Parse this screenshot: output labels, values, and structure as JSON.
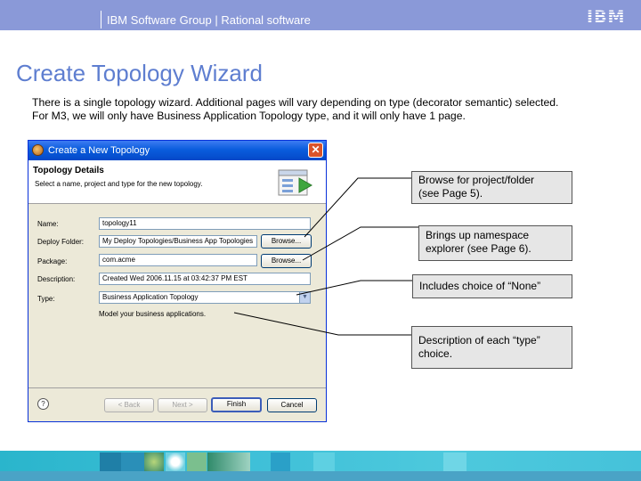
{
  "header": {
    "group_text": "IBM Software Group | Rational software",
    "logo_text": "IBM"
  },
  "slide": {
    "title": "Create Topology Wizard",
    "body_lines": [
      "There is a single topology wizard.  Additional pages will vary depending on type (decorator semantic) selected.",
      "For M3, we will only have Business Application Topology type, and it will only have 1 page."
    ]
  },
  "dialog": {
    "title": "Create a New Topology",
    "close_glyph": "✕",
    "banner": {
      "title": "Topology Details",
      "description": "Select a name, project and type for the new topology."
    },
    "fields": {
      "name_label": "Name:",
      "name_value": "topology11",
      "deploy_folder_label": "Deploy Folder:",
      "deploy_folder_value": "My Deploy Topologies/Business App Topologies",
      "package_label": "Package:",
      "package_value": "com.acme",
      "description_label": "Description:",
      "description_value": "Created Wed 2006.11.15 at 03:42:37 PM EST",
      "type_label": "Type:",
      "type_value": "Business Application Topology",
      "type_help": "Model your business applications."
    },
    "browse_label_1": "Browse...",
    "browse_label_2": "Browse...",
    "help_glyph": "?",
    "buttons": {
      "back": "< Back",
      "next": "Next >",
      "finish": "Finish",
      "cancel": "Cancel"
    }
  },
  "callouts": {
    "browse": [
      "Browse for project/folder",
      "(see Page 5)."
    ],
    "namespace": [
      "Brings up namespace",
      "explorer (see Page 6)."
    ],
    "none": [
      "Includes choice of “None”"
    ],
    "description": [
      "Description of each “type”",
      "choice."
    ]
  },
  "colors": {
    "header_band": "#8a99d8",
    "title_blue": "#5e7ed0",
    "callout_fill": "#e6e6e6",
    "footer_band": "#3fc0d8"
  }
}
